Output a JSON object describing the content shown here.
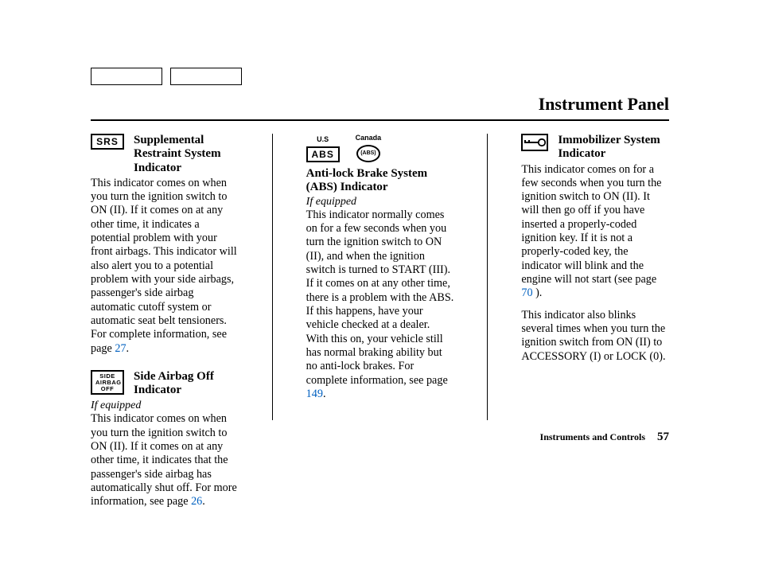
{
  "page_title": "Instrument Panel",
  "footer_section": "Instruments and Controls",
  "footer_page": "57",
  "col1": {
    "srs_icon": "SRS",
    "srs_heading": "Supplemental Restraint System Indicator",
    "srs_body_a": "This indicator comes on when you turn the ignition switch to ON (II). If it comes on at any other time, it indicates a potential problem with your front airbags. This indicator will also alert you to a potential problem with your side airbags, passenger's side airbag automatic cutoff system or automatic seat belt tensioners. For complete information, see page",
    "srs_page": "27",
    "srs_body_b": ".",
    "side_icon_l1": "SIDE",
    "side_icon_l2": "AIRBAG",
    "side_icon_l3": "OFF",
    "side_heading": "Side Airbag Off Indicator",
    "side_ifeq": "If equipped",
    "side_body_a": "This indicator comes on when you turn the ignition switch to ON (II). If it comes on at any other time, it indicates that the passenger's side airbag has automatically shut off. For more information, see page",
    "side_page": "26",
    "side_body_b": "."
  },
  "col2": {
    "region_us": "U.S",
    "region_ca": "Canada",
    "abs_icon": "ABS",
    "abs_oval": "(ABS)",
    "abs_heading": "Anti-lock Brake System (ABS) Indicator",
    "abs_ifeq": "If equipped",
    "abs_body_a": "This indicator normally comes on for a few seconds when you turn the ignition switch to ON (II), and when the ignition switch is turned to START (III). If it comes on at any other time, there is a problem with the ABS. If this happens, have your vehicle checked at a dealer. With this on, your vehicle still has normal braking ability but no anti-lock brakes. For complete information, see page",
    "abs_page": "149",
    "abs_body_b": "."
  },
  "col3": {
    "immo_heading": "Immobilizer System Indicator",
    "immo_body_a": "This indicator comes on for a few seconds when you turn the ignition switch to ON (II). It will then go off if you have inserted a properly-coded ignition key. If it is not a properly-coded key, the indicator will blink and the engine will not start (see page",
    "immo_page": "70",
    "immo_body_b": ").",
    "immo_body_c": "This indicator also blinks several times when you turn the ignition switch from ON (II) to ACCESSORY (I) or LOCK (0)."
  }
}
